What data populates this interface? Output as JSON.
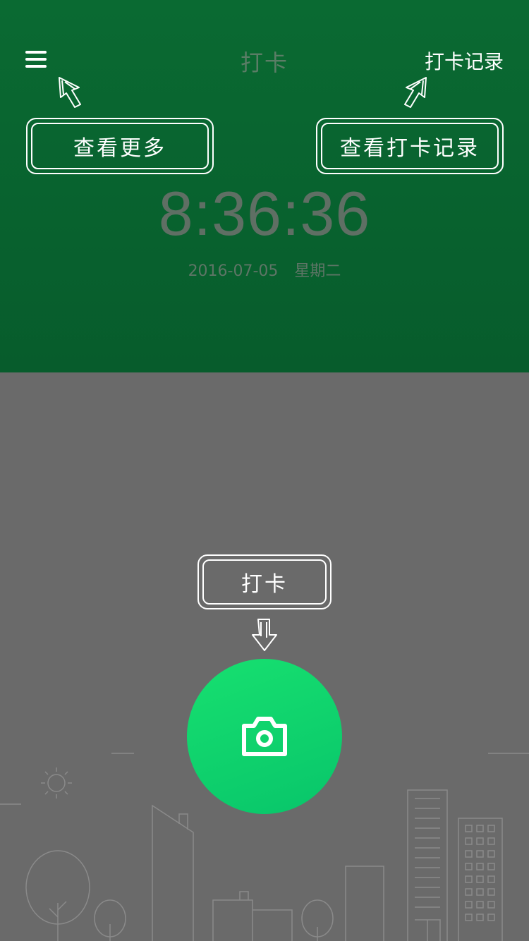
{
  "nav": {
    "title": "打卡",
    "right_link": "打卡记录"
  },
  "hints": {
    "more": "查看更多",
    "records": "查看打卡记录",
    "punch": "打卡"
  },
  "clock": {
    "time": "8:36:36",
    "date": "2016-07-05",
    "weekday": "星期二"
  },
  "icons": {
    "menu": "menu-icon",
    "camera": "camera-icon",
    "sun": "sun-icon",
    "arrows": "hint-arrow-icon"
  },
  "colors": {
    "header_green": "#0a6a32",
    "body_gray": "#6a6a6a",
    "button_green": "#0fd66d"
  }
}
